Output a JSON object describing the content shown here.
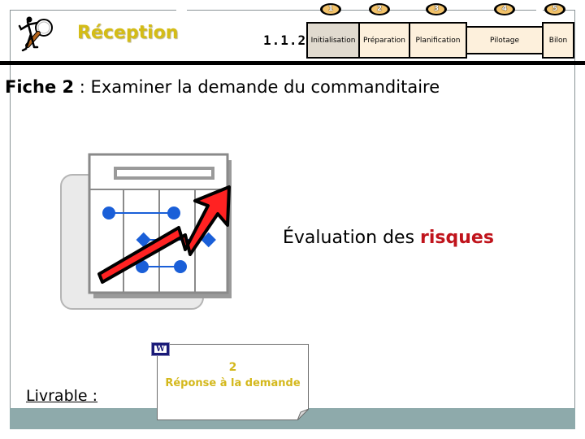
{
  "header": {
    "section_title": "Réception",
    "section_number": "1.1.2",
    "logo_icon": "magnifier-figure-icon",
    "steps": [
      {
        "number": "1",
        "label": "Initialisation",
        "active": true
      },
      {
        "number": "2",
        "label": "Préparation",
        "active": false
      },
      {
        "number": "3",
        "label": "Planification",
        "active": false
      },
      {
        "number": "4",
        "label": "Pilotage",
        "active": false
      },
      {
        "number": "5",
        "label": "Bilon",
        "active": false
      }
    ]
  },
  "fiche": {
    "prefix": "Fiche 2",
    "separator": " : ",
    "title": "Examiner la demande du commanditaire"
  },
  "main": {
    "illustration_icon": "risk-chart-arrow-icon",
    "evaluation_text": "Évaluation des ",
    "evaluation_highlight": "risques",
    "highlight_color": "#c0141c"
  },
  "deliverable": {
    "label": "Livrable :",
    "doc_icon": "word-document-icon",
    "doc_icon_letter": "W",
    "doc_number": "2",
    "doc_title": "Réponse à la demande"
  },
  "colors": {
    "title_yellow": "#d4bc16",
    "step_bg": "#fdf0dc",
    "step_active_bg": "#e0dacf",
    "band": "#8eaaab"
  }
}
